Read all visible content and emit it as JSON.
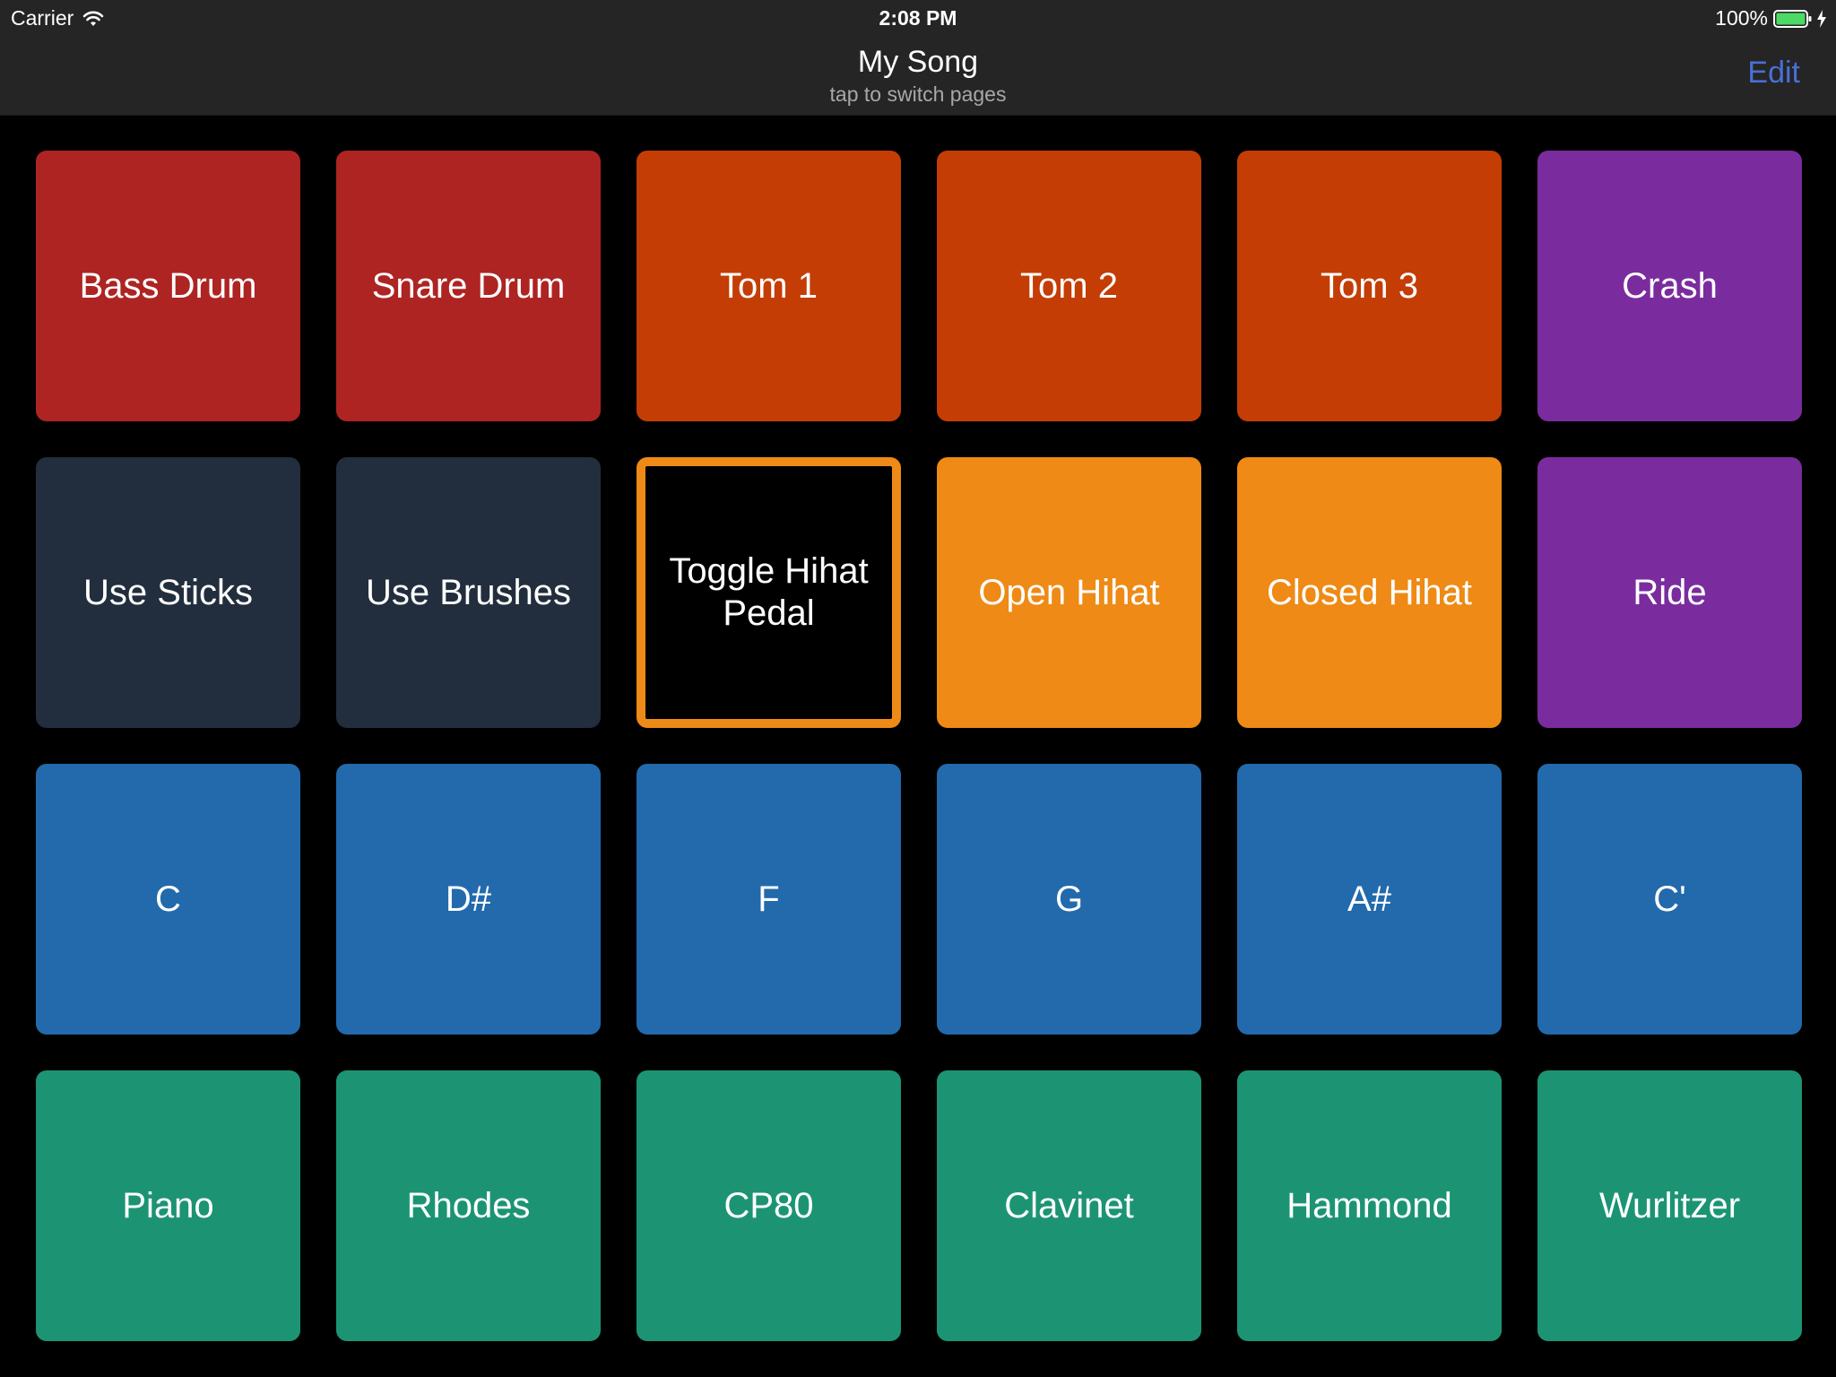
{
  "status_bar": {
    "carrier": "Carrier",
    "time": "2:08 PM",
    "battery_percent": "100%",
    "battery_level": 1.0,
    "icons": [
      "wifi-icon",
      "battery-icon",
      "charging-bolt-icon"
    ]
  },
  "nav": {
    "title": "My Song",
    "subtitle": "tap to switch pages",
    "edit_label": "Edit",
    "edit_color": "#4a6fd6"
  },
  "pads": [
    [
      {
        "label": "Bass Drum",
        "color": "#ad2423"
      },
      {
        "label": "Snare Drum",
        "color": "#ad2423"
      },
      {
        "label": "Tom 1",
        "color": "#c43d04"
      },
      {
        "label": "Tom 2",
        "color": "#c43d04"
      },
      {
        "label": "Tom 3",
        "color": "#c43d04"
      },
      {
        "label": "Crash",
        "color": "#7a2c9e"
      }
    ],
    [
      {
        "label": "Use Sticks",
        "color": "#222e3d"
      },
      {
        "label": "Use Brushes",
        "color": "#222e3d"
      },
      {
        "label": "Toggle Hihat Pedal",
        "color": "#000000",
        "selected": true,
        "border_color": "#ee8a17"
      },
      {
        "label": "Open Hihat",
        "color": "#ee8a15"
      },
      {
        "label": "Closed Hihat",
        "color": "#ee8a15"
      },
      {
        "label": "Ride",
        "color": "#7a2c9e"
      }
    ],
    [
      {
        "label": "C",
        "color": "#226aac"
      },
      {
        "label": "D#",
        "color": "#226aac"
      },
      {
        "label": "F",
        "color": "#226aac"
      },
      {
        "label": "G",
        "color": "#226aac"
      },
      {
        "label": "A#",
        "color": "#226aac"
      },
      {
        "label": "C'",
        "color": "#226aac"
      }
    ],
    [
      {
        "label": "Piano",
        "color": "#1c9474"
      },
      {
        "label": "Rhodes",
        "color": "#1c9474"
      },
      {
        "label": "CP80",
        "color": "#1c9474"
      },
      {
        "label": "Clavinet",
        "color": "#1c9474"
      },
      {
        "label": "Hammond",
        "color": "#1c9474"
      },
      {
        "label": "Wurlitzer",
        "color": "#1c9474"
      }
    ]
  ]
}
